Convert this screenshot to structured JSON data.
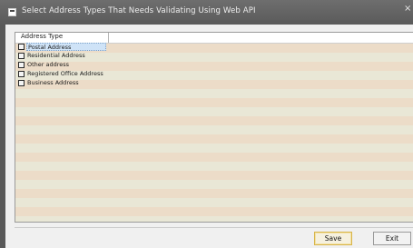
{
  "window": {
    "title": "Select Address Types That Needs Validating Using Web API",
    "close_label": "×"
  },
  "grid": {
    "column_header": "Address Type",
    "items": [
      {
        "label": "Postal Address",
        "checked": false,
        "selected": true
      },
      {
        "label": "Residential Address",
        "checked": false,
        "selected": false
      },
      {
        "label": "Other address",
        "checked": false,
        "selected": false
      },
      {
        "label": "Registered Office Address",
        "checked": false,
        "selected": false
      },
      {
        "label": "Business Address",
        "checked": false,
        "selected": false
      }
    ]
  },
  "buttons": {
    "save": "Save",
    "exit": "Exit"
  },
  "colors": {
    "stripe_a": "#ecdcc8",
    "stripe_b": "#e9e7d6"
  }
}
